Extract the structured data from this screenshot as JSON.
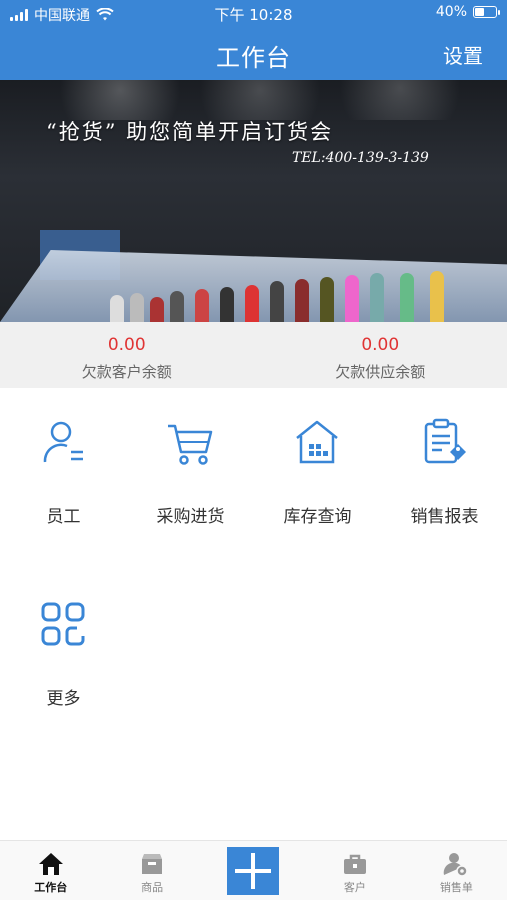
{
  "status_bar": {
    "carrier": "中国联通",
    "time": "下午 10:28",
    "battery": "40%"
  },
  "header": {
    "title": "工作台",
    "settings": "设置"
  },
  "banner": {
    "headline": "“抢货” 助您简单开启订货会",
    "tel": "TEL:400-139-3-139"
  },
  "balances": [
    {
      "amount": "0.00",
      "label": "欠款客户余额"
    },
    {
      "amount": "0.00",
      "label": "欠款供应余额"
    }
  ],
  "tiles": [
    {
      "label": "员工",
      "icon": "user-icon"
    },
    {
      "label": "采购进货",
      "icon": "cart-icon"
    },
    {
      "label": "库存查询",
      "icon": "warehouse-icon"
    },
    {
      "label": "销售报表",
      "icon": "report-icon"
    },
    {
      "label": "更多",
      "icon": "grid-icon"
    }
  ],
  "tabbar": [
    {
      "label": "工作台",
      "icon": "home-icon"
    },
    {
      "label": "商品",
      "icon": "box-icon"
    },
    {
      "label": "",
      "icon": "plus-icon"
    },
    {
      "label": "客户",
      "icon": "briefcase-icon"
    },
    {
      "label": "销售单",
      "icon": "person-settings-icon"
    }
  ],
  "colors": {
    "primary": "#3a86d6",
    "amount": "#e03434"
  }
}
